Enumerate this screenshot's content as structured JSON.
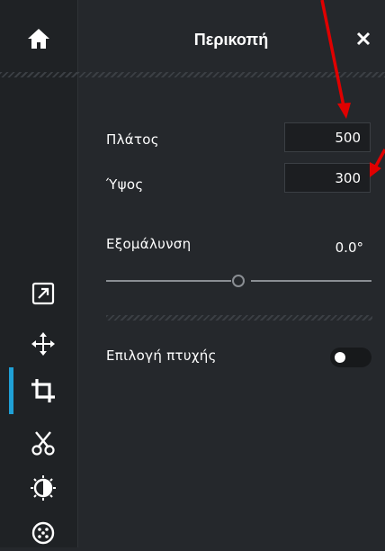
{
  "panel": {
    "title": "Περικοπή"
  },
  "fields": {
    "width": {
      "label": "Πλάτος",
      "value": "500"
    },
    "height": {
      "label": "Ύψος",
      "value": "300"
    }
  },
  "straighten": {
    "label": "Εξομάλυνση",
    "value": "0.0°",
    "slider_fraction": 0.5
  },
  "fold_option": {
    "label": "Επιλογή πτυχής",
    "enabled": false
  },
  "sidebar": {
    "tools": [
      "home-icon",
      "resize-icon",
      "move-icon",
      "crop-icon",
      "cut-icon",
      "adjust-icon",
      "filter-icon"
    ],
    "active_tool": "crop-icon"
  },
  "colors": {
    "background": "#25282c",
    "sidebar": "#1f2225",
    "accent": "#1fa0d6",
    "annotation_arrow": "#e00000"
  }
}
